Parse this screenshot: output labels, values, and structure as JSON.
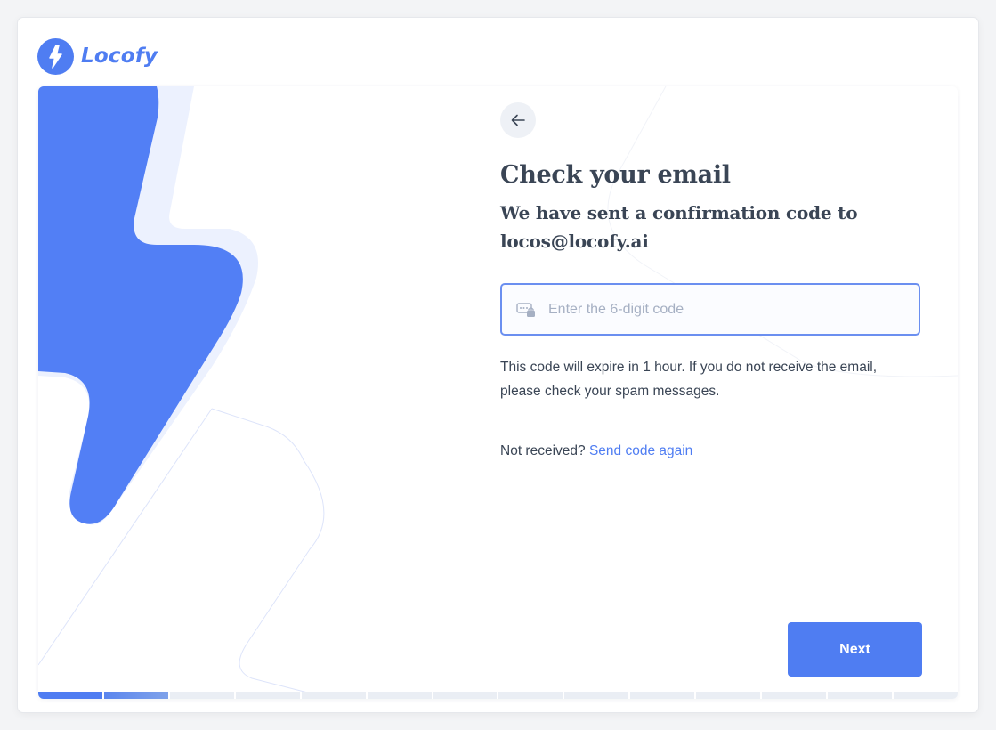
{
  "brand": {
    "name": "Locofy",
    "color": "#4f7df2"
  },
  "header": {
    "back_icon": "arrow-left-icon",
    "title": "Check your email",
    "subtitle": "We have sent a confirmation code to locos@locofy.ai"
  },
  "code_field": {
    "icon": "password-lock-icon",
    "placeholder": "Enter the 6-digit code",
    "value": ""
  },
  "help_text": "This code will expire in 1 hour. If you do not receive the email, please check your spam messages.",
  "resend": {
    "prompt": "Not received?",
    "link_label": "Send code again"
  },
  "actions": {
    "next_label": "Next"
  },
  "progress": {
    "total_steps": 14,
    "completed_steps": 2,
    "colors": {
      "done": "#4f7df2",
      "pending": "#eaeef4"
    }
  }
}
